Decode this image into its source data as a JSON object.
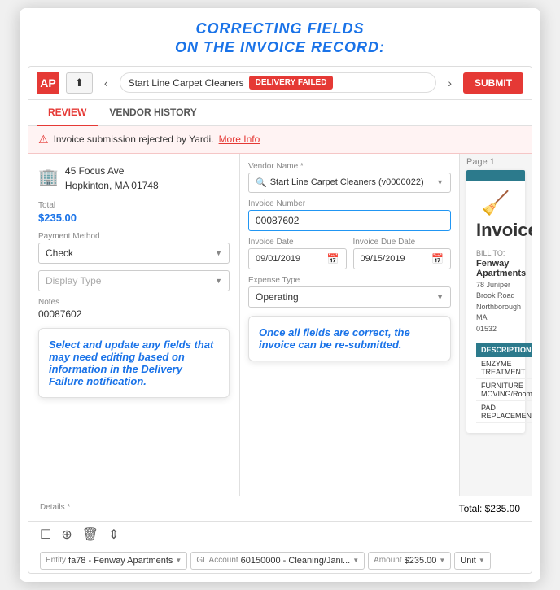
{
  "tutorial": {
    "title_line1": "CORRECTING FIELDS",
    "title_line2": "ON THE INVOICE RECORD:"
  },
  "topbar": {
    "logo": "AP",
    "upload_label": "⬆",
    "nav_prev": "‹",
    "nav_next": "›",
    "vendor_name": "Start Line Carpet Cleaners",
    "delivery_failed": "DELIVERY FAILED",
    "submit_label": "SUBMIT"
  },
  "tabs": {
    "review": "REVIEW",
    "vendor_history": "VENDOR HISTORY"
  },
  "alert": {
    "message": "Invoice submission rejected by Yardi.",
    "more_info": "More Info"
  },
  "form": {
    "vendor_label": "Vendor Name *",
    "vendor_value": "Start Line Carpet Cleaners (v0000022)",
    "invoice_number_label": "Invoice Number",
    "invoice_number_value": "00087602",
    "invoice_date_label": "Invoice Date",
    "invoice_date_value": "09/01/2019",
    "invoice_due_date_label": "Invoice Due Date",
    "invoice_due_date_value": "09/15/2019",
    "expense_type_label": "Expense Type",
    "expense_type_value": "Operating",
    "payment_method_label": "Payment Method",
    "payment_method_value": "Check",
    "display_type_label": "Display Type",
    "display_type_value": "",
    "notes_label": "Notes",
    "notes_value": "00087602",
    "address_line1": "45 Focus Ave",
    "address_line2": "Hopkinton, MA 01748",
    "total_label": "Total",
    "total_value": "$235.00"
  },
  "callouts": {
    "left": "Select and update any fields that may need editing based on information in the Delivery Failure notification.",
    "right": "Once all fields are correct, the invoice can be re-submitted."
  },
  "invoice_preview": {
    "page_label": "Page 1",
    "invoice_title": "Invoice",
    "bill_to_label": "BILL TO:",
    "bill_to_company": "Fenway Apartments",
    "bill_to_address": "78 Juniper Brook Road\nNorthborough MA\n01532",
    "table_headers": [
      "DESCRIPTION"
    ],
    "table_rows": [
      "ENZYME TREATMENT",
      "FURNITURE MOVING/Room",
      "PAD REPLACEMENT/YRD"
    ]
  },
  "bottom": {
    "details_label": "Details *",
    "total_label": "Total: $235.00"
  },
  "line_items": {
    "entity_label": "Entity",
    "entity_value": "fa78 - Fenway Apartments",
    "gl_account_label": "GL Account",
    "gl_account_value": "60150000 - Cleaning/Jani...",
    "amount_label": "Amount",
    "amount_value": "$235.00",
    "unit_label": "Unit"
  }
}
